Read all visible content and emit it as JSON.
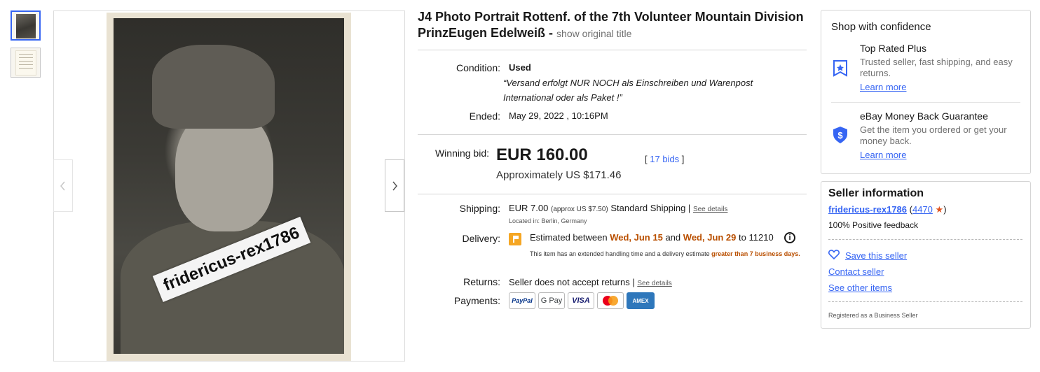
{
  "gallery": {
    "watermark": "fridericus-rex1786",
    "thumbnails": [
      "portrait",
      "document"
    ]
  },
  "listing": {
    "title": "J4 Photo Portrait Rottenf. of the 7th Volunteer Mountain Division PrinzEugen Edelweiß -",
    "show_original": "show original title",
    "condition_label": "Condition:",
    "condition_value": "Used",
    "seller_note": "“Versand erfolgt NUR NOCH als Einschreiben und Warenpost International oder als Paket !”",
    "ended_label": "Ended:",
    "ended_value": "May 29, 2022 , 10:16PM",
    "winning_bid_label": "Winning bid:",
    "price": "EUR 160.00",
    "approx": "Approximately US $171.46",
    "bids_open": "[",
    "bids_link": "17 bids",
    "bids_close": "]",
    "shipping_label": "Shipping:",
    "shipping_price": "EUR 7.00",
    "shipping_approx": "(approx US $7.50)",
    "shipping_service": "Standard Shipping |",
    "see_details": "See details",
    "located": "Located in: Berlin, Germany",
    "delivery_label": "Delivery:",
    "delivery_pre": "Estimated between",
    "delivery_date1": "Wed, Jun 15",
    "delivery_and": "and",
    "delivery_date2": "Wed, Jun 29",
    "delivery_to": "to 11210",
    "delivery_note": "This item has an extended handling time and a delivery estimate",
    "delivery_note_orange": "greater than 7 business days.",
    "returns_label": "Returns:",
    "returns_value": "Seller does not accept returns |",
    "returns_details": "See details",
    "payments_label": "Payments:",
    "payment_methods": [
      "PayPal",
      "G Pay",
      "VISA",
      "mastercard",
      "AMEX"
    ]
  },
  "confidence": {
    "heading": "Shop with confidence",
    "items": [
      {
        "title": "Top Rated Plus",
        "desc": "Trusted seller, fast shipping, and easy returns.",
        "link": "Learn more",
        "icon": "top-rated-shield-icon"
      },
      {
        "title": "eBay Money Back Guarantee",
        "desc": "Get the item you ordered or get your money back.",
        "link": "Learn more",
        "icon": "money-back-shield-icon"
      }
    ]
  },
  "seller": {
    "heading": "Seller information",
    "name": "fridericus-rex1786",
    "open_paren": "(",
    "feedback_count": "4470",
    "close_paren": ")",
    "positive": "100% Positive feedback",
    "save": "Save this seller",
    "contact": "Contact seller",
    "other_items": "See other items",
    "registered": "Registered as a Business Seller"
  },
  "colors": {
    "link": "#3665f3",
    "orange": "#b94f00",
    "star": "#e0531f"
  }
}
